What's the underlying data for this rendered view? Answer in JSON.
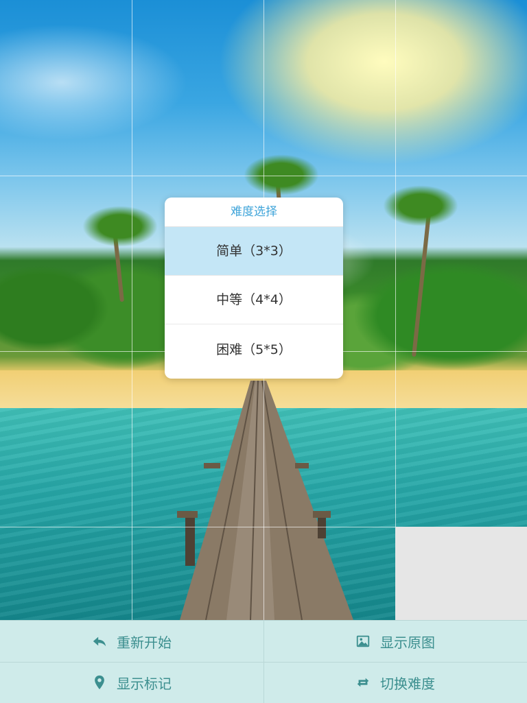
{
  "puzzle": {
    "grid_size": 4,
    "empty_tile": "bottom-right"
  },
  "dialog": {
    "title": "难度选择",
    "options": [
      {
        "label": "简单（3*3）",
        "selected": true
      },
      {
        "label": "中等（4*4）",
        "selected": false
      },
      {
        "label": "困难（5*5）",
        "selected": false
      }
    ]
  },
  "toolbar": {
    "restart_label": "重新开始",
    "show_original_label": "显示原图",
    "show_marks_label": "显示标记",
    "switch_difficulty_label": "切换难度",
    "icons": {
      "restart": "reply-arrow-icon",
      "show_original": "image-icon",
      "show_marks": "map-pin-icon",
      "switch_difficulty": "repeat-icon"
    }
  },
  "colors": {
    "toolbar_bg": "#cfebea",
    "toolbar_text": "#3c8f8f",
    "dialog_title": "#3fa4d9",
    "selected_option_bg": "#c4e6f6"
  }
}
